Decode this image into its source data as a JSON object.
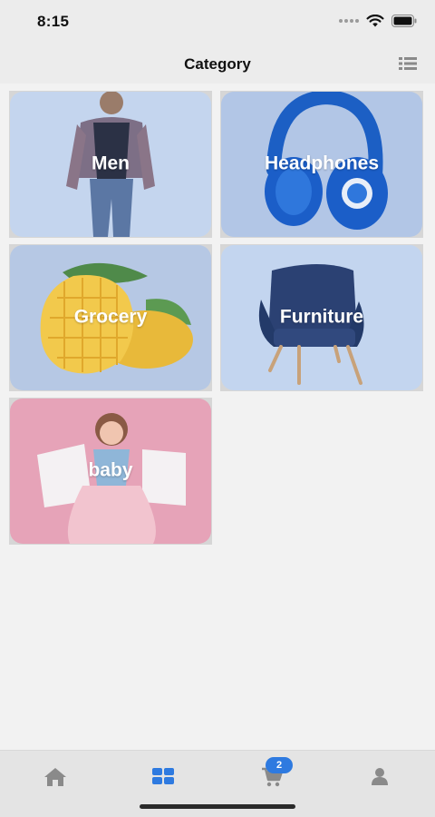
{
  "status_bar": {
    "time": "8:15"
  },
  "header": {
    "title": "Category",
    "right_icon": "list-view-icon"
  },
  "categories": [
    {
      "label": "Men",
      "image": "man-in-plaid-shirt",
      "tint": "#c4d5ee"
    },
    {
      "label": "Headphones",
      "image": "blue-headphones",
      "tint": "#b2c6e6"
    },
    {
      "label": "Grocery",
      "image": "cut-mango",
      "tint": "#b6c8e4"
    },
    {
      "label": "Furniture",
      "image": "blue-armchair",
      "tint": "#c3d5ef"
    },
    {
      "label": "baby",
      "image": "girl-with-shopping-bags",
      "tint": "#e6a3b8"
    }
  ],
  "tab_bar": {
    "tabs": [
      {
        "name": "home",
        "icon": "home-icon",
        "active": false
      },
      {
        "name": "categories",
        "icon": "grid-icon",
        "active": true
      },
      {
        "name": "cart",
        "icon": "cart-icon",
        "active": false
      },
      {
        "name": "profile",
        "icon": "user-icon",
        "active": false
      }
    ],
    "cart_badge": "2",
    "active_color": "#2e7ae0",
    "inactive_color": "#8a8a8a"
  }
}
